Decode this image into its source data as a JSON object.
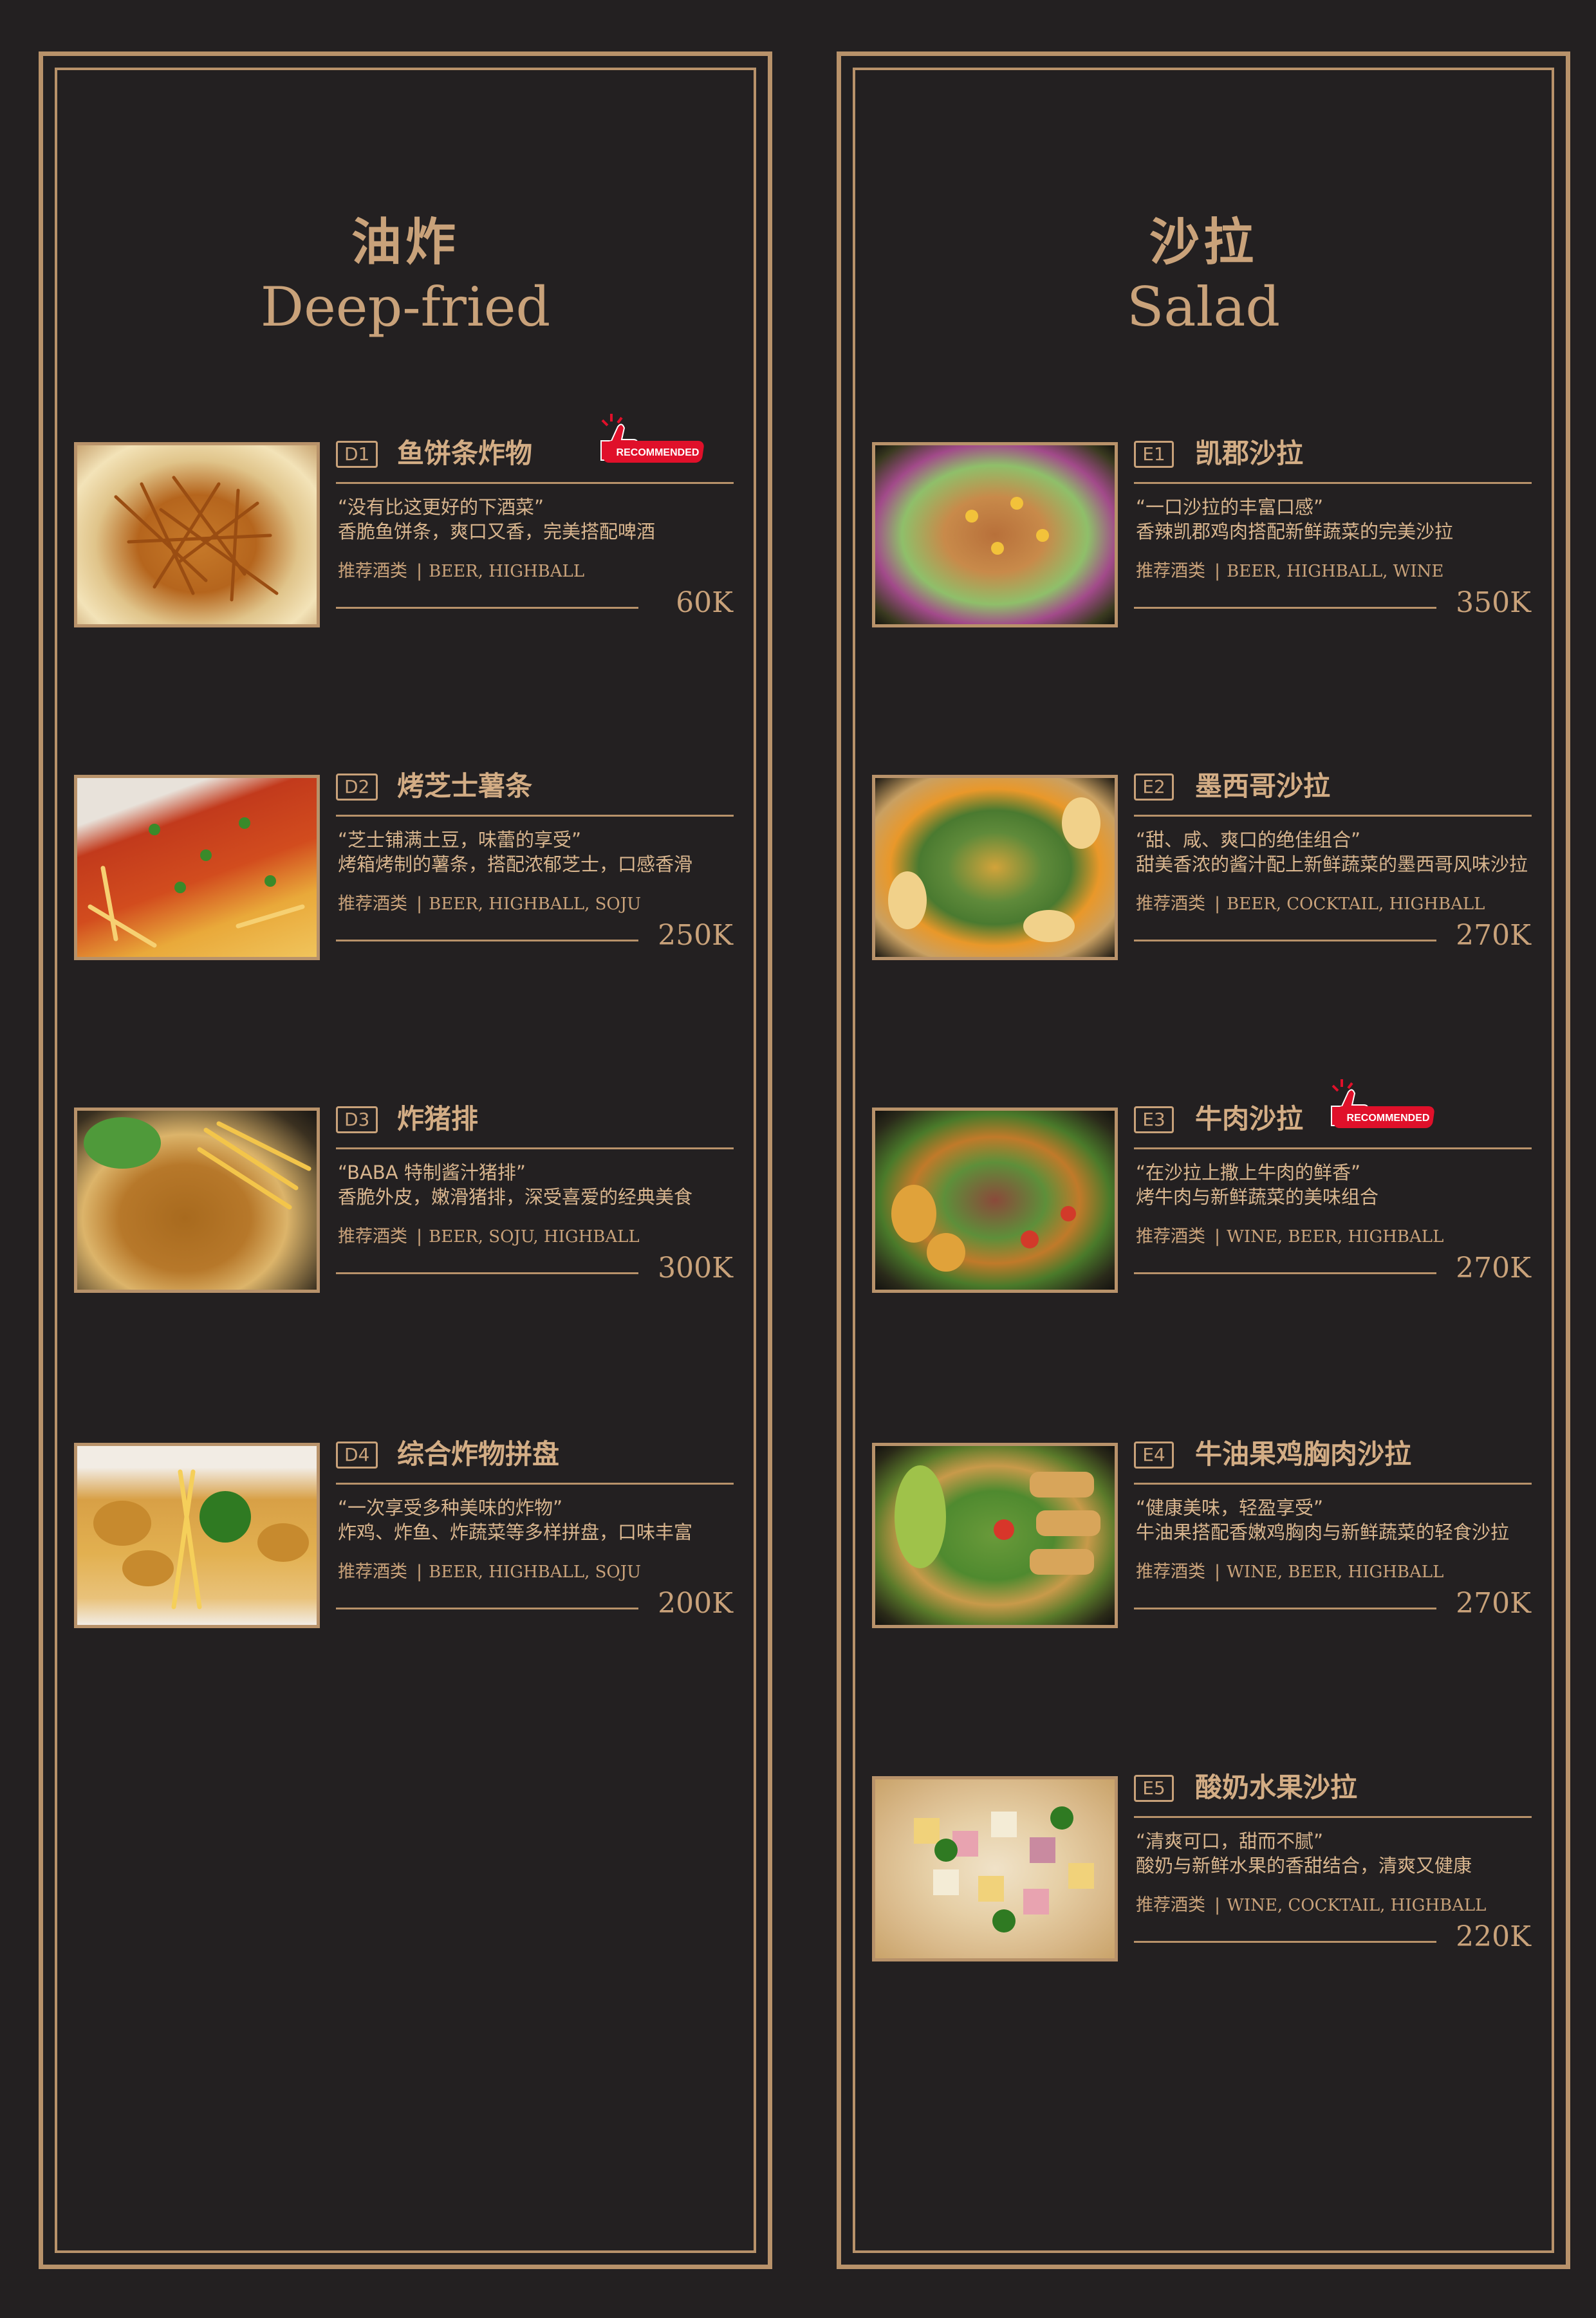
{
  "left": {
    "heading_zh": "油炸",
    "heading_en": "Deep-fried",
    "items": [
      {
        "code": "D1",
        "name": "鱼饼条炸物",
        "quote": "“没有比这更好的下酒菜”",
        "desc": "香脆鱼饼条，爽口又香，完美搭配啤酒",
        "drink_label": "推荐酒类",
        "drink_sep": "|",
        "drinks": "BEER, HIGHBALL",
        "price": "60K",
        "badge": "RECOMMENDED"
      },
      {
        "code": "D2",
        "name": "烤芝士薯条",
        "quote": "“芝士铺满土豆，味蕾的享受”",
        "desc": "烤箱烤制的薯条，搭配浓郁芝士，口感香滑",
        "drink_label": "推荐酒类",
        "drink_sep": "|",
        "drinks": "BEER, HIGHBALL, SOJU",
        "price": "250K"
      },
      {
        "code": "D3",
        "name": "炸猪排",
        "quote": "“BABA 特制酱汁猪排”",
        "desc": "香脆外皮，嫩滑猪排，深受喜爱的经典美食",
        "drink_label": "推荐酒类",
        "drink_sep": "|",
        "drinks": "BEER, SOJU, HIGHBALL",
        "price": "300K"
      },
      {
        "code": "D4",
        "name": "综合炸物拼盘",
        "quote": "“一次享受多种美味的炸物”",
        "desc": "炸鸡、炸鱼、炸蔬菜等多样拼盘，口味丰富",
        "drink_label": "推荐酒类",
        "drink_sep": "|",
        "drinks": "BEER, HIGHBALL, SOJU",
        "price": "200K"
      }
    ]
  },
  "right": {
    "heading_zh": "沙拉",
    "heading_en": "Salad",
    "items": [
      {
        "code": "E1",
        "name": "凯郡沙拉",
        "quote": "“一口沙拉的丰富口感”",
        "desc": "香辣凯郡鸡肉搭配新鲜蔬菜的完美沙拉",
        "drink_label": "推荐酒类",
        "drink_sep": "|",
        "drinks": "BEER, HIGHBALL, WINE",
        "price": "350K"
      },
      {
        "code": "E2",
        "name": "墨西哥沙拉",
        "quote": "“甜、咸、爽口的绝佳组合”",
        "desc": "甜美香浓的酱汁配上新鲜蔬菜的墨西哥风味沙拉",
        "drink_label": "推荐酒类",
        "drink_sep": "|",
        "drinks": "BEER, COCKTAIL, HIGHBALL",
        "price": "270K"
      },
      {
        "code": "E3",
        "name": "牛肉沙拉",
        "quote": "“在沙拉上撒上牛肉的鲜香”",
        "desc": "烤牛肉与新鲜蔬菜的美味组合",
        "drink_label": "推荐酒类",
        "drink_sep": "|",
        "drinks": "WINE, BEER, HIGHBALL",
        "price": "270K",
        "badge": "RECOMMENDED"
      },
      {
        "code": "E4",
        "name": "牛油果鸡胸肉沙拉",
        "quote": "“健康美味，轻盈享受”",
        "desc": "牛油果搭配香嫩鸡胸肉与新鲜蔬菜的轻食沙拉",
        "drink_label": "推荐酒类",
        "drink_sep": "|",
        "drinks": "WINE, BEER, HIGHBALL",
        "price": "270K"
      },
      {
        "code": "E5",
        "name": "酸奶水果沙拉",
        "quote": "“清爽可口，甜而不腻”",
        "desc": "酸奶与新鲜水果的香甜结合，清爽又健康",
        "drink_label": "推荐酒类",
        "drink_sep": "|",
        "drinks": "WINE, COCKTAIL, HIGHBALL",
        "price": "220K"
      }
    ]
  },
  "colors": {
    "background": "#232021",
    "gold": "#b8926a",
    "text": "#d8b58e",
    "badge": "#e0102a"
  },
  "icons": {
    "badge": "thumbs-up-icon"
  }
}
